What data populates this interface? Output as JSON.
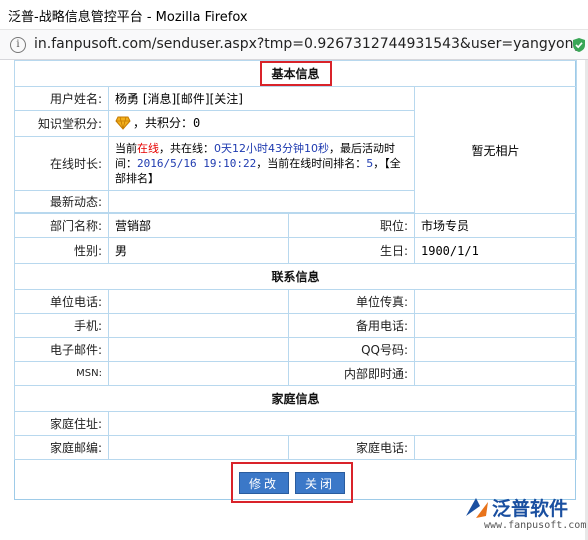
{
  "window": {
    "title": "泛普-战略信息管控平台 - Mozilla Firefox"
  },
  "address_bar": {
    "url": "in.fanpusoft.com/senduser.aspx?tmp=0.9267312744931543&user=yangyong"
  },
  "sections": {
    "basic": "基本信息",
    "contact": "联系信息",
    "family": "家庭信息"
  },
  "basic_info": {
    "username_label": "用户姓名:",
    "username_value": "杨勇",
    "username_actions": [
      "[消息]",
      "[邮件]",
      "[关注]"
    ],
    "knowledge_label": "知识堂积分:",
    "knowledge_value": "，共积分：0",
    "online_label": "在线时长:",
    "online_prefix": "当前",
    "online_status": "在线",
    "online_mid": "，共在线：",
    "online_duration": "0天12小时43分钟10秒",
    "online_last_label": "，最后活动时间：",
    "online_last_time": "2016/5/16 19:10:22",
    "online_rank_label": "，当前在线时间排名：",
    "online_rank": "5",
    "online_all_rank": "，【全部排名】",
    "latest_label": "最新动态:",
    "photo_text": "暂无相片",
    "dept_label": "部门名称:",
    "dept_value": "营销部",
    "position_label": "职位:",
    "position_value": "市场专员",
    "gender_label": "性别:",
    "gender_value": "男",
    "birthday_label": "生日:",
    "birthday_value": "1900/1/1"
  },
  "contact_info": {
    "work_phone_label": "单位电话:",
    "work_fax_label": "单位传真:",
    "mobile_label": "手机:",
    "backup_phone_label": "备用电话:",
    "email_label": "电子邮件:",
    "qq_label": "QQ号码:",
    "msn_label": "MSN:",
    "im_label": "内部即时通:"
  },
  "family_info": {
    "address_label": "家庭住址:",
    "zip_label": "家庭邮编:",
    "phone_label": "家庭电话:"
  },
  "buttons": {
    "edit": "修改",
    "close": "关闭"
  },
  "logo": {
    "name": "泛普软件",
    "site": "www.fanpusoft.com"
  },
  "colors": {
    "accent_red": "#d9232a",
    "button_blue": "#3b78c8",
    "border_blue": "#b8d8ee"
  }
}
